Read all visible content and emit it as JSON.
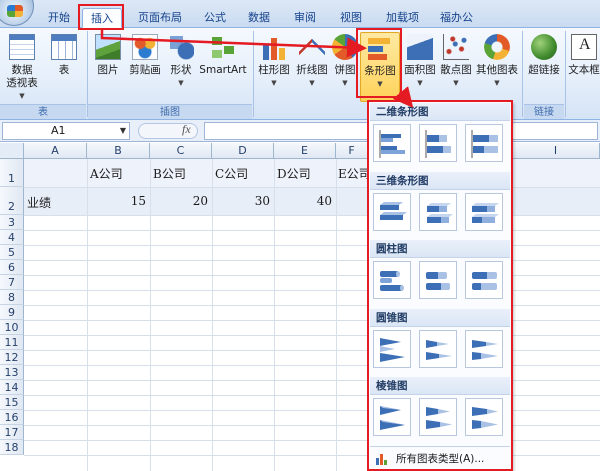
{
  "tabs": [
    "开始",
    "插入",
    "页面布局",
    "公式",
    "数据",
    "审阅",
    "视图",
    "加载项",
    "福办公"
  ],
  "ribbon": {
    "groups": {
      "tables": {
        "caption": "表",
        "pivot": "数据\n透视表",
        "table": "表"
      },
      "illustrations": {
        "caption": "插图",
        "picture": "图片",
        "clipart": "剪贴画",
        "shape": "形状",
        "smartart": "SmartArt"
      },
      "charts": {
        "column": "柱形图",
        "line": "折线图",
        "pie": "饼图",
        "bar": "条形图",
        "area": "面积图",
        "scatter": "散点图",
        "other": "其他图表"
      },
      "links": {
        "caption": "链接",
        "hyperlink": "超链接"
      },
      "text": {
        "textbox": "文本框"
      }
    }
  },
  "formula_bar": {
    "name_box": "A1",
    "fx": "fx",
    "value": ""
  },
  "sheet": {
    "columns": [
      "A",
      "B",
      "C",
      "D",
      "E",
      "F",
      "G",
      "H",
      "I"
    ],
    "rows": [
      "1",
      "2",
      "3",
      "4",
      "5",
      "6",
      "7",
      "8",
      "9",
      "10",
      "11",
      "12",
      "13",
      "14",
      "15",
      "16",
      "17",
      "18"
    ],
    "headers": [
      "A公司",
      "B公司",
      "C公司",
      "D公司",
      "E公司"
    ],
    "row_label": "业绩",
    "values": [
      "15",
      "20",
      "30",
      "40"
    ]
  },
  "dropdown": {
    "sections": [
      "二维条形图",
      "三维条形图",
      "圆柱图",
      "圆锥图",
      "棱锥图"
    ],
    "all_types": "所有图表类型(A)..."
  },
  "colors": {
    "annotation_red": "#e51b24",
    "accent_blue": "#3c6fb6",
    "selected_orange": "#ffd35a"
  },
  "icons": [
    "office-orb-icon",
    "pivot-table-icon",
    "table-icon",
    "picture-icon",
    "clipart-icon",
    "shape-icon",
    "smartart-icon",
    "column-chart-icon",
    "line-chart-icon",
    "pie-chart-icon",
    "bar-chart-icon",
    "area-chart-icon",
    "scatter-chart-icon",
    "other-chart-icon",
    "hyperlink-icon",
    "textbox-icon"
  ]
}
